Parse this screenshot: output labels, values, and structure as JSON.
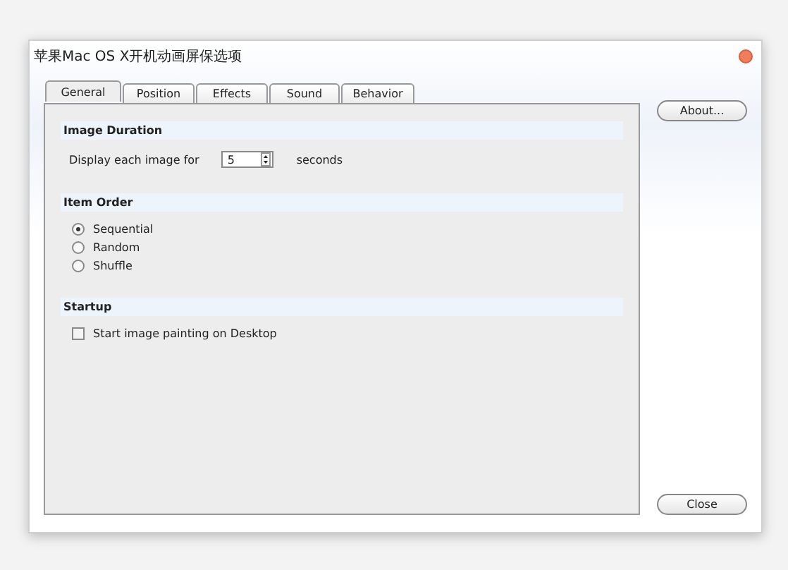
{
  "window": {
    "title": "苹果Mac OS X开机动画屏保选项"
  },
  "tabs": [
    {
      "label": "General",
      "selected": true
    },
    {
      "label": "Position",
      "selected": false
    },
    {
      "label": "Effects",
      "selected": false
    },
    {
      "label": "Sound",
      "selected": false
    },
    {
      "label": "Behavior",
      "selected": false
    }
  ],
  "sections": [
    {
      "title": "Image Duration",
      "kind": "spinner",
      "label": "Display each image for",
      "value": "5",
      "unit": "seconds"
    },
    {
      "title": "Item Order",
      "kind": "radios",
      "options": [
        {
          "label": "Sequential",
          "selected": true
        },
        {
          "label": "Random",
          "selected": false
        },
        {
          "label": "Shuffle",
          "selected": false
        }
      ]
    },
    {
      "title": "Startup",
      "kind": "checkbox",
      "label": "Start image painting on Desktop",
      "checked": false
    }
  ],
  "buttons": [
    "About...",
    "Close"
  ]
}
